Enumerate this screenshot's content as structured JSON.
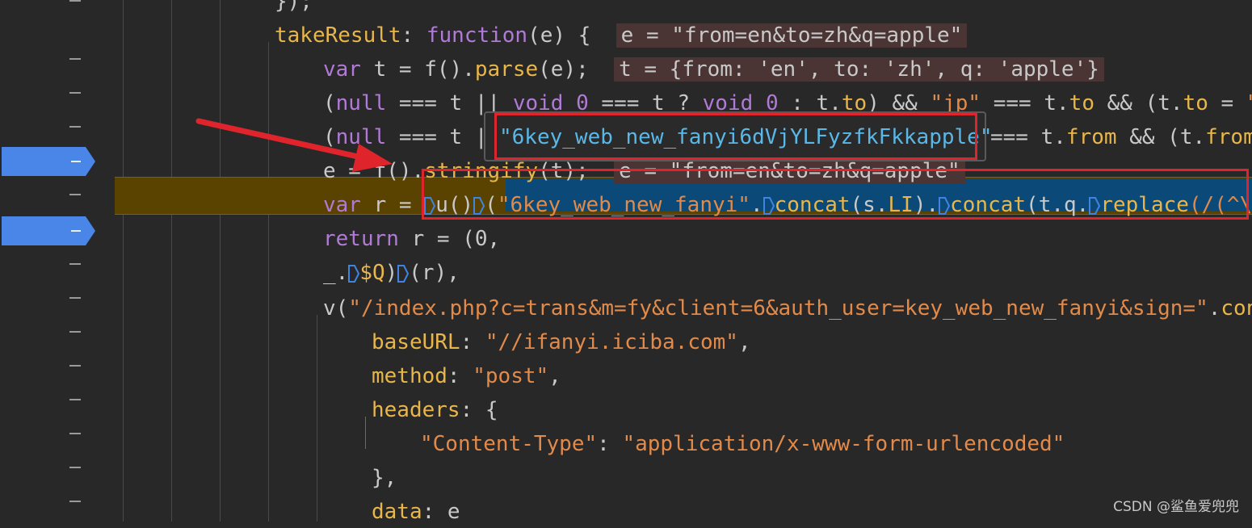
{
  "gutter": {
    "dash_symbol": "–",
    "breakpoint_rows": [
      5,
      7
    ]
  },
  "current_line_number": 5,
  "lines": [
    {
      "tokens": [
        {
          "t": "});",
          "c": "plain"
        }
      ]
    },
    {
      "tokens": [
        {
          "t": "takeResult",
          "c": "prop"
        },
        {
          "t": ": ",
          "c": "plain"
        },
        {
          "t": "function",
          "c": "kw"
        },
        {
          "t": "(e) {  ",
          "c": "plain"
        },
        {
          "t": "e = \"from=en&to=zh&q=apple\"",
          "c": "inl"
        }
      ]
    },
    {
      "tokens": [
        {
          "t": "var",
          "c": "kw"
        },
        {
          "t": " t = f().",
          "c": "plain"
        },
        {
          "t": "parse",
          "c": "fn"
        },
        {
          "t": "(e);  ",
          "c": "plain"
        },
        {
          "t": "t = {from: 'en', to: 'zh', q: 'apple'}",
          "c": "inl"
        }
      ]
    },
    {
      "tokens": [
        {
          "t": "(",
          "c": "plain"
        },
        {
          "t": "null",
          "c": "kw"
        },
        {
          "t": " === t || ",
          "c": "plain"
        },
        {
          "t": "void",
          "c": "kw"
        },
        {
          "t": " ",
          "c": "plain"
        },
        {
          "t": "0",
          "c": "num"
        },
        {
          "t": " === t ? ",
          "c": "plain"
        },
        {
          "t": "void",
          "c": "kw"
        },
        {
          "t": " ",
          "c": "plain"
        },
        {
          "t": "0",
          "c": "num"
        },
        {
          "t": " : t.",
          "c": "plain"
        },
        {
          "t": "to",
          "c": "prop"
        },
        {
          "t": ") && ",
          "c": "plain"
        },
        {
          "t": "\"jp\"",
          "c": "str"
        },
        {
          "t": " === t.",
          "c": "plain"
        },
        {
          "t": "to",
          "c": "prop"
        },
        {
          "t": " && (t.",
          "c": "plain"
        },
        {
          "t": "to",
          "c": "prop"
        },
        {
          "t": " = ",
          "c": "plain"
        },
        {
          "t": "\"ja",
          "c": "str"
        }
      ]
    },
    {
      "tokens": [
        {
          "t": "(",
          "c": "plain"
        },
        {
          "t": "null",
          "c": "kw"
        },
        {
          "t": " === t |",
          "c": "plain"
        }
      ],
      "right_tokens": [
        {
          "t": "=== t.",
          "c": "plain"
        },
        {
          "t": "from",
          "c": "prop"
        },
        {
          "t": " && (t.",
          "c": "plain"
        },
        {
          "t": "from",
          "c": "prop"
        }
      ]
    },
    {
      "tokens": [
        {
          "t": "e = ",
          "c": "plain"
        },
        {
          "t": "f().",
          "c": "plain"
        },
        {
          "t": "stringify",
          "c": "fn"
        },
        {
          "t": "(t);  ",
          "c": "plain"
        },
        {
          "t": "e = \"from=en&to=zh&q=apple\"",
          "c": "inl"
        }
      ]
    },
    {
      "tokens": [
        {
          "t": "var",
          "c": "kw"
        },
        {
          "t": " r = ",
          "c": "plain"
        },
        {
          "t": "D",
          "c": "step"
        },
        {
          "t": "u",
          "c": "plain"
        },
        {
          "t": "()",
          "c": "plain"
        },
        {
          "t": "D",
          "c": "step"
        },
        {
          "t": "(",
          "c": "plain"
        },
        {
          "t": "\"6key_web_new_fanyi\"",
          "c": "str"
        },
        {
          "t": ".",
          "c": "plain"
        },
        {
          "t": "D",
          "c": "step"
        },
        {
          "t": "concat",
          "c": "fn"
        },
        {
          "t": "(s.",
          "c": "plain"
        },
        {
          "t": "LI",
          "c": "prop"
        },
        {
          "t": ").",
          "c": "plain"
        },
        {
          "t": "D",
          "c": "step"
        },
        {
          "t": "concat",
          "c": "fn"
        },
        {
          "t": "(t.q.",
          "c": "plain"
        },
        {
          "t": "D",
          "c": "step"
        },
        {
          "t": "replace",
          "c": "fn"
        },
        {
          "t": "(/(^\\",
          "c": "str"
        }
      ]
    },
    {
      "tokens": [
        {
          "t": "return",
          "c": "kw"
        },
        {
          "t": " r = (0,",
          "c": "plain"
        }
      ]
    },
    {
      "tokens": [
        {
          "t": "_.",
          "c": "plain"
        },
        {
          "t": "D",
          "c": "step"
        },
        {
          "t": "$Q",
          "c": "prop"
        },
        {
          "t": ")",
          "c": "plain"
        },
        {
          "t": "D",
          "c": "step"
        },
        {
          "t": "(r),",
          "c": "plain"
        }
      ]
    },
    {
      "tokens": [
        {
          "t": "v(",
          "c": "plain"
        },
        {
          "t": "\"/index.php?c=trans&m=fy&client=6&auth_user=key_web_new_fanyi&sign=\"",
          "c": "str"
        },
        {
          "t": ".",
          "c": "plain"
        },
        {
          "t": "conca",
          "c": "fn"
        }
      ]
    },
    {
      "tokens": [
        {
          "t": "baseURL",
          "c": "prop"
        },
        {
          "t": ": ",
          "c": "plain"
        },
        {
          "t": "\"//ifanyi.iciba.com\"",
          "c": "str"
        },
        {
          "t": ",",
          "c": "plain"
        }
      ]
    },
    {
      "tokens": [
        {
          "t": "method",
          "c": "prop"
        },
        {
          "t": ": ",
          "c": "plain"
        },
        {
          "t": "\"post\"",
          "c": "str"
        },
        {
          "t": ",",
          "c": "plain"
        }
      ]
    },
    {
      "tokens": [
        {
          "t": "headers",
          "c": "prop"
        },
        {
          "t": ": {",
          "c": "plain"
        }
      ]
    },
    {
      "tokens": [
        {
          "t": "\"Content-Type\"",
          "c": "str"
        },
        {
          "t": ": ",
          "c": "plain"
        },
        {
          "t": "\"application/x-www-form-urlencoded\"",
          "c": "str"
        }
      ]
    },
    {
      "tokens": [
        {
          "t": "},",
          "c": "plain"
        }
      ]
    },
    {
      "tokens": [
        {
          "t": "data",
          "c": "prop"
        },
        {
          "t": ": e",
          "c": "plain"
        }
      ]
    }
  ],
  "tooltip": {
    "value": "\"6key_web_new_fanyi6dVjYLFyzfkFkkapple\""
  },
  "colors": {
    "background": "#282828",
    "keyword": "#b07ad6",
    "property": "#e8b64a",
    "string": "#e28a4a",
    "current_line": "#5a4200",
    "selection": "#0b4a78",
    "breakpoint": "#4a86e8",
    "annotation": "#e0242c"
  },
  "watermark": "CSDN @鲨鱼爱兜兜"
}
